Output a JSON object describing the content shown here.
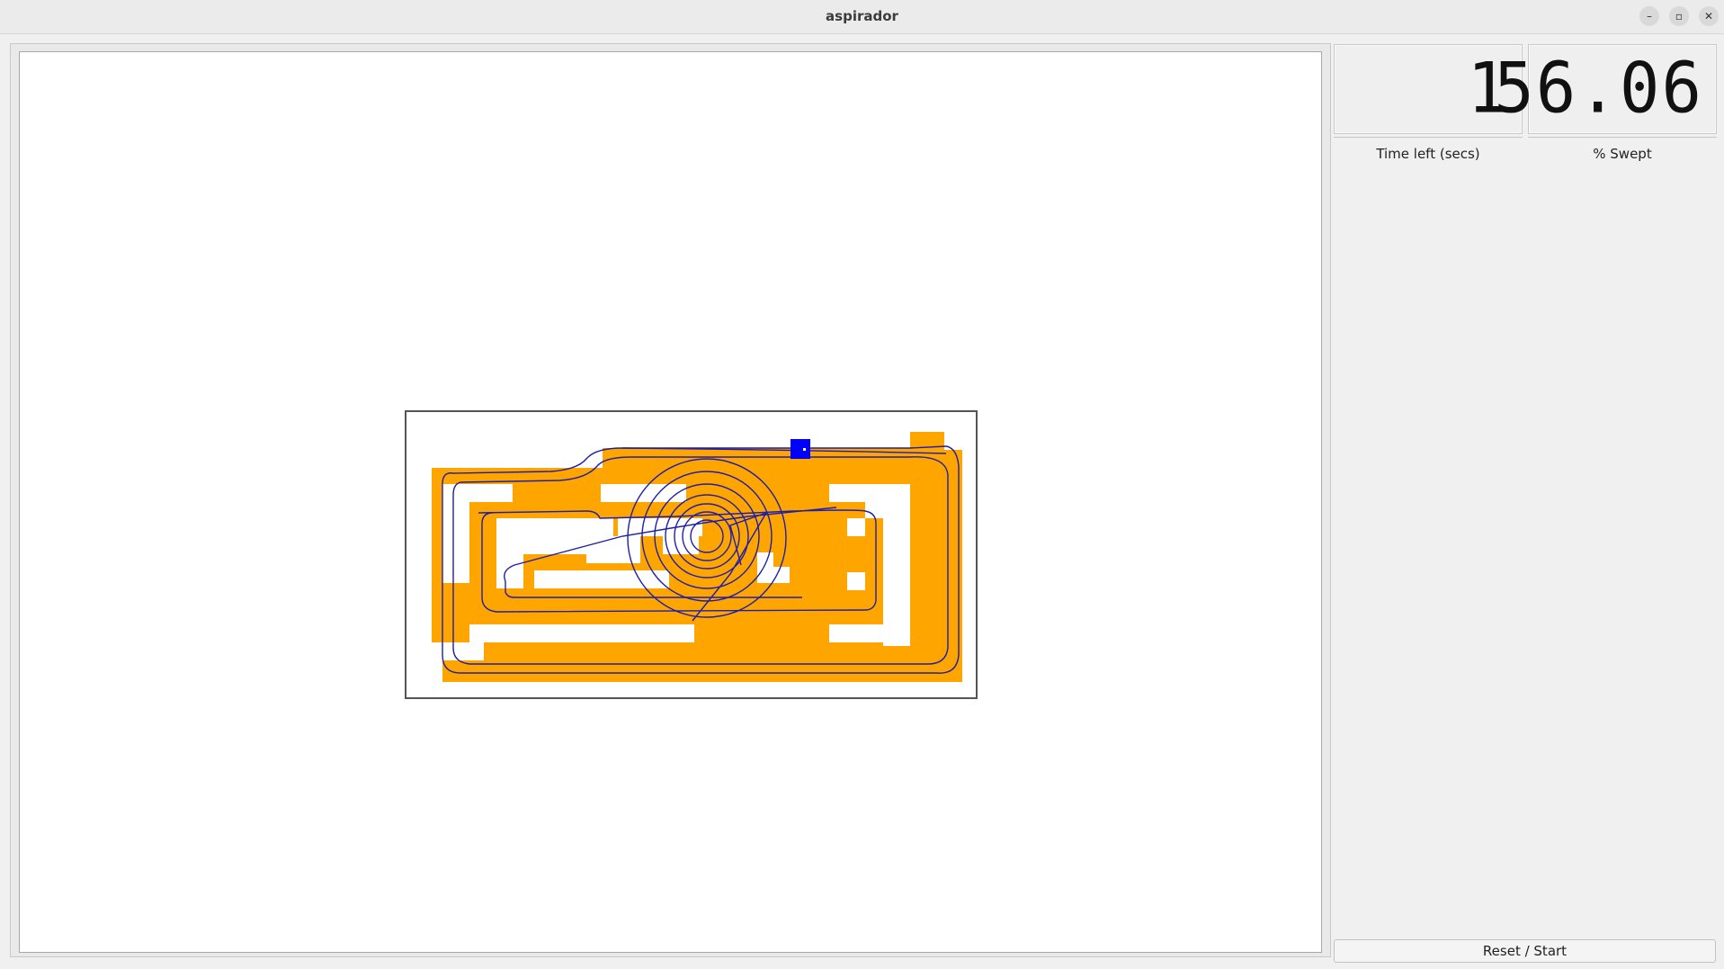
{
  "window": {
    "title": "aspirador",
    "minimize_icon": "–",
    "maximize_icon": "▫",
    "close_icon": "✕"
  },
  "displays": {
    "time_left": {
      "value": "1",
      "label": "Time left (secs)"
    },
    "percent_swept": {
      "value": "56.06",
      "label": "% Swept"
    }
  },
  "controls": {
    "reset_label": "Reset / Start"
  },
  "colors": {
    "swept": "#ffa500",
    "robot": "#0000ff",
    "path": "#1e1eaa",
    "room_border": "#555555",
    "background": "#ffffff"
  }
}
